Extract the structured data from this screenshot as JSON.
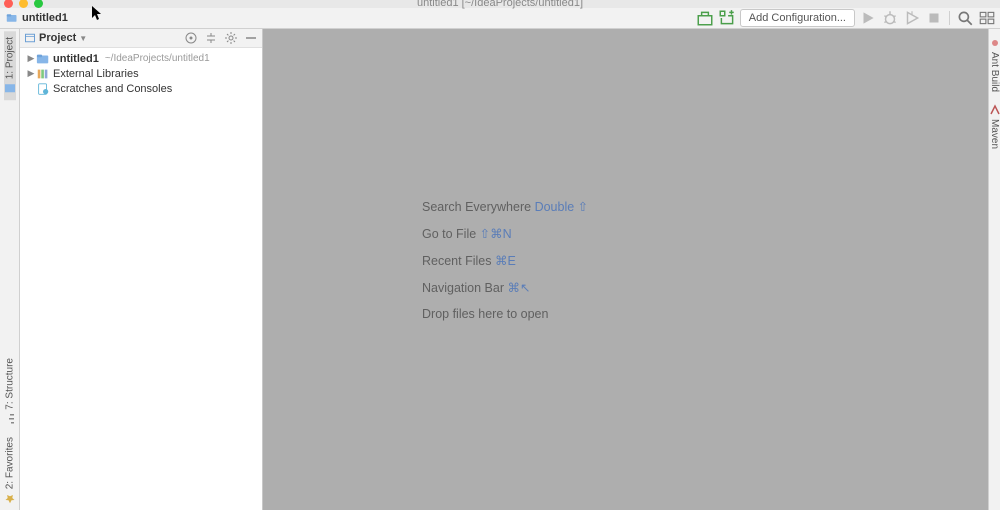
{
  "window": {
    "title": "untitled1 [~/IdeaProjects/untitled1]"
  },
  "breadcrumb": {
    "project": "untitled1"
  },
  "toolbar": {
    "add_config": "Add Configuration..."
  },
  "left_gutter": {
    "project": "1: Project",
    "structure": "7: Structure",
    "favorites": "2: Favorites"
  },
  "right_gutter": {
    "ant": "Ant Build",
    "maven": "Maven"
  },
  "panel": {
    "title": "Project",
    "tree": [
      {
        "label": "untitled1",
        "path": "~/IdeaProjects/untitled1",
        "bold": true,
        "icon": "folder",
        "arrow": true
      },
      {
        "label": "External Libraries",
        "icon": "lib",
        "arrow": true
      },
      {
        "label": "Scratches and Consoles",
        "icon": "scratch",
        "arrow": false
      }
    ]
  },
  "hints": [
    {
      "text": "Search Everywhere ",
      "kb": "Double ⇧"
    },
    {
      "text": "Go to File ",
      "kb": "⇧⌘N"
    },
    {
      "text": "Recent Files ",
      "kb": "⌘E"
    },
    {
      "text": "Navigation Bar ",
      "kb": "⌘↖"
    },
    {
      "text": "Drop files here to open",
      "kb": ""
    }
  ]
}
